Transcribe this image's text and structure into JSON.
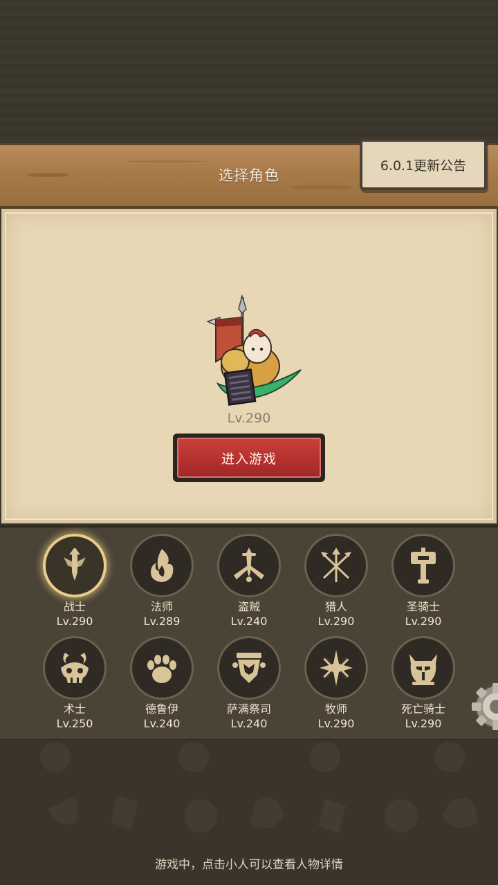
{
  "header": {
    "title": "选择角色",
    "notice_button": "6.0.1更新公告"
  },
  "selected_character": {
    "level": "Lv.290",
    "enter_button": "进入游戏"
  },
  "classes": [
    {
      "name": "战士",
      "level": "Lv.290",
      "icon": "warrior-sword-icon",
      "selected": true
    },
    {
      "name": "法师",
      "level": "Lv.289",
      "icon": "mage-flame-icon"
    },
    {
      "name": "盗贼",
      "level": "Lv.240",
      "icon": "rogue-daggers-icon"
    },
    {
      "name": "猎人",
      "level": "Lv.290",
      "icon": "hunter-arrows-icon"
    },
    {
      "name": "圣骑士",
      "level": "Lv.290",
      "icon": "paladin-hammer-icon"
    },
    {
      "name": "术士",
      "level": "Lv.250",
      "icon": "warlock-skull-icon"
    },
    {
      "name": "德鲁伊",
      "level": "Lv.240",
      "icon": "druid-paw-icon"
    },
    {
      "name": "萨满祭司",
      "level": "Lv.240",
      "icon": "shaman-totem-icon"
    },
    {
      "name": "牧师",
      "level": "Lv.290",
      "icon": "priest-star-icon"
    },
    {
      "name": "死亡骑士",
      "level": "Lv.290",
      "icon": "death-knight-helm-icon"
    }
  ],
  "footer": {
    "tip": "游戏中，点击小人可以查看人物详情"
  },
  "colors": {
    "accent_gold": "#e8cd8a",
    "enter_red": "#b3302d",
    "emblem_gold": "#d9c49a"
  }
}
